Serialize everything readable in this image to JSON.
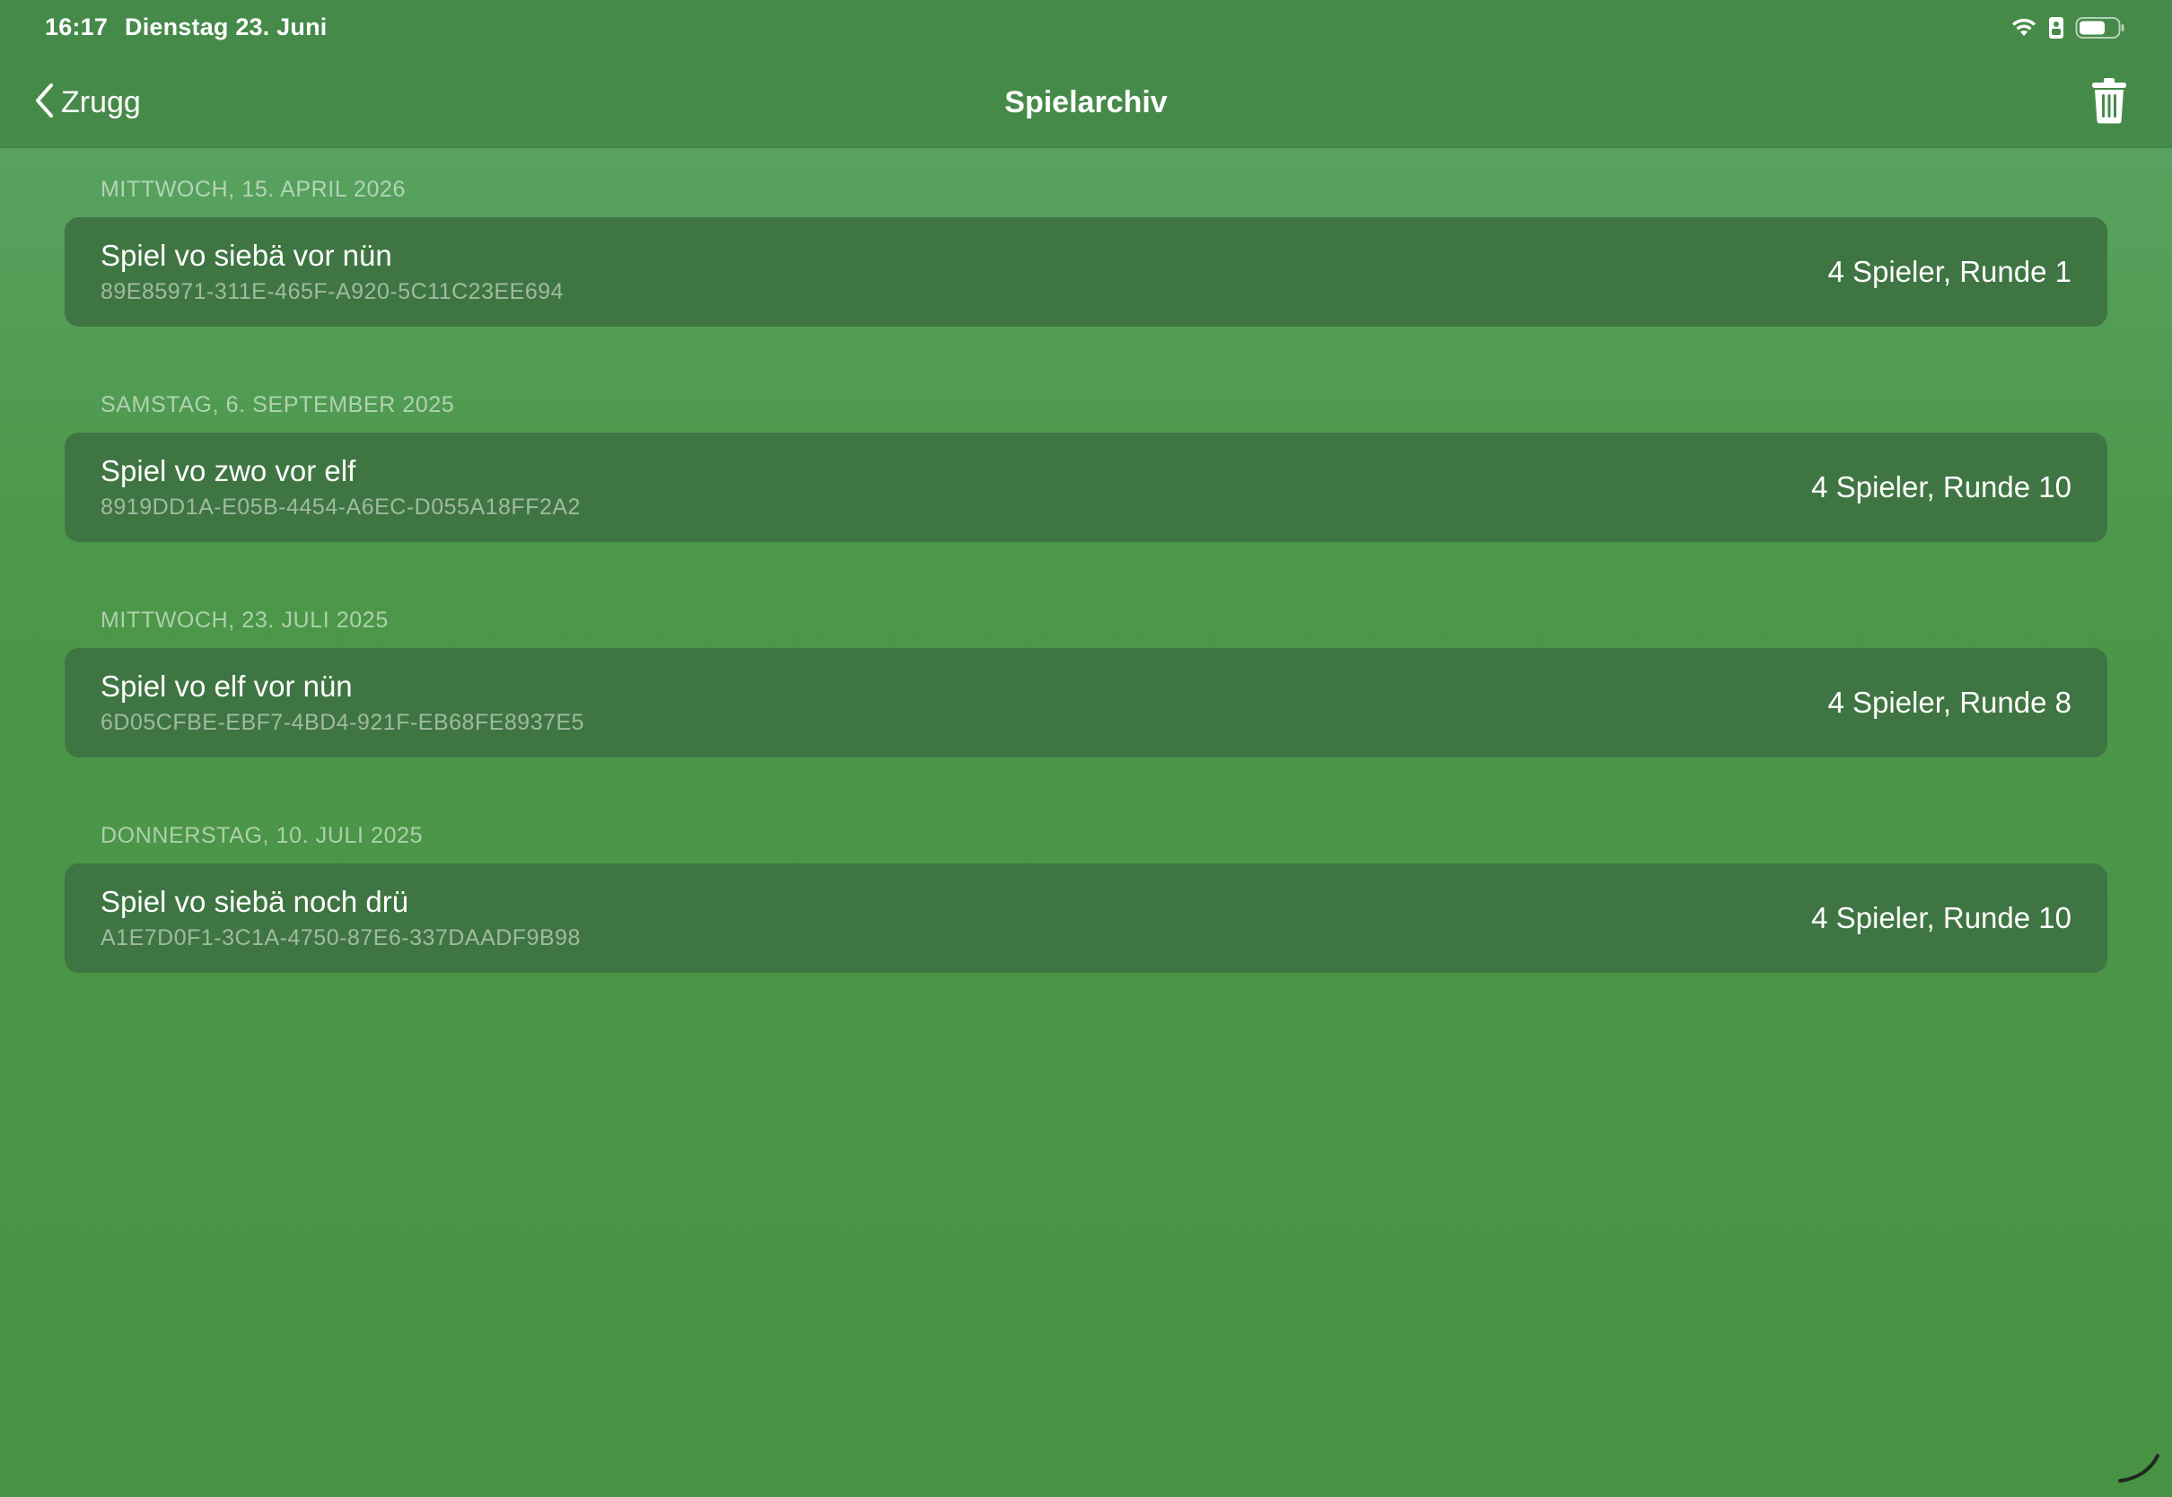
{
  "status_bar": {
    "time": "16:17",
    "date": "Dienstag 23. Juni",
    "icons": [
      "wifi-icon",
      "sim-icon",
      "battery-icon"
    ]
  },
  "nav": {
    "back_label": "Zrugg",
    "title": "Spielarchiv",
    "trash_icon": "trash-icon"
  },
  "sections": [
    {
      "header": "MITTWOCH, 15. APRIL 2026",
      "row": {
        "title": "Spiel vo siebä vor nün",
        "id": "89E85971-311E-465F-A920-5C11C23EE694",
        "detail": "4 Spieler, Runde 1"
      }
    },
    {
      "header": "SAMSTAG, 6. SEPTEMBER 2025",
      "row": {
        "title": "Spiel vo zwo vor elf",
        "id": "8919DD1A-E05B-4454-A6EC-D055A18FF2A2",
        "detail": "4 Spieler, Runde 10"
      }
    },
    {
      "header": "MITTWOCH, 23. JULI 2025",
      "row": {
        "title": "Spiel vo elf vor nün",
        "id": "6D05CFBE-EBF7-4BD4-921F-EB68FE8937E5",
        "detail": "4 Spieler, Runde 8"
      }
    },
    {
      "header": "DONNERSTAG, 10. JULI 2025",
      "row": {
        "title": "Spiel vo siebä noch drü",
        "id": "A1E7D0F1-3C1A-4750-87E6-337DAADF9B98",
        "detail": "4 Spieler, Runde 10"
      }
    }
  ],
  "colors": {
    "nav_background": "#468a49",
    "row_background": "#3f7542",
    "page_background": "#4c9749"
  }
}
